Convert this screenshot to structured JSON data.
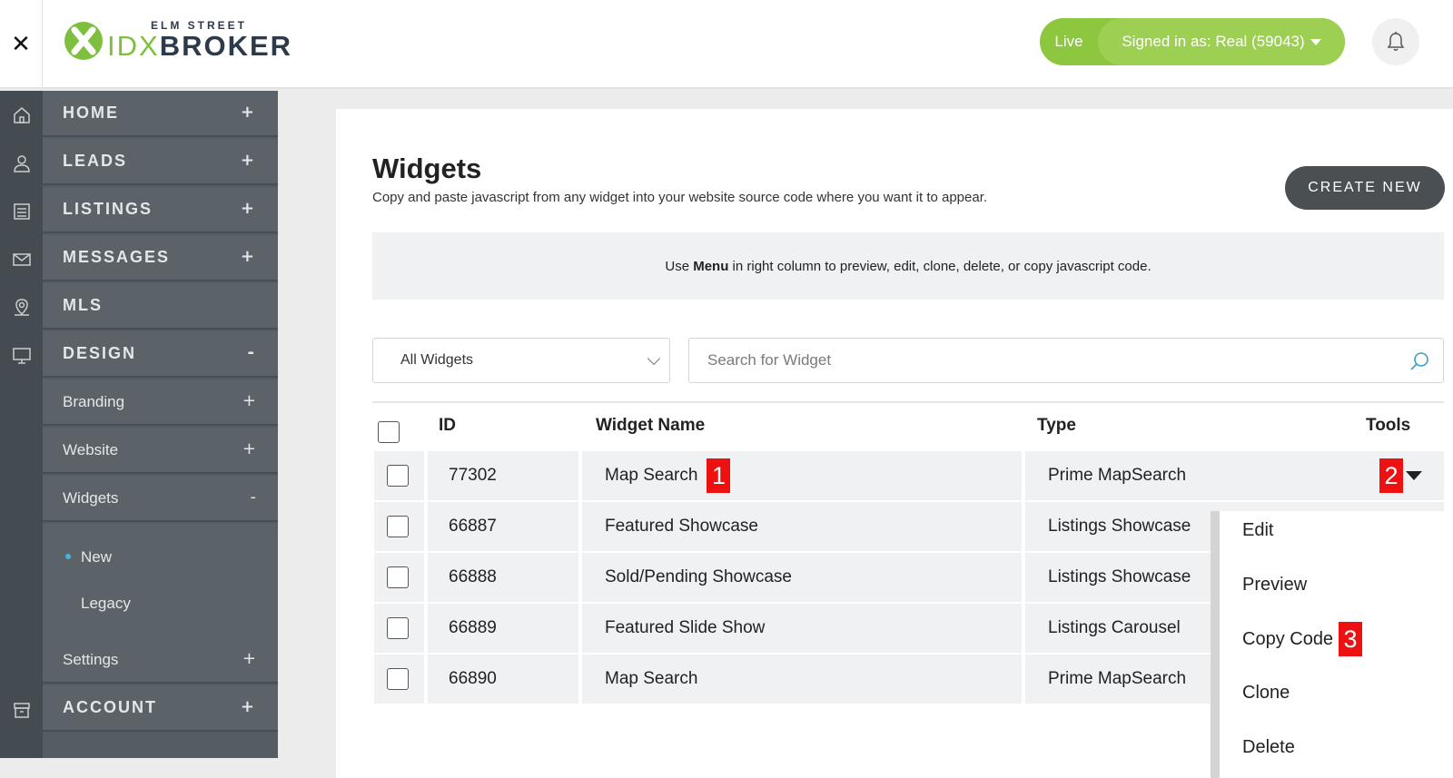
{
  "header": {
    "close_label": "✕",
    "logo": {
      "small": "ELM STREET",
      "idx": "IDX",
      "broker": "BROKER"
    },
    "status": {
      "live": "Live",
      "signed_in": "Signed in as: Real (59043)"
    },
    "colors": {
      "accent": "#8dc63f",
      "sidebar": "#5b6369",
      "rail": "#444c52"
    }
  },
  "rail_icons": [
    "home-icon",
    "user-icon",
    "listings-icon",
    "mail-icon",
    "location-icon",
    "monitor-icon",
    "archive-icon"
  ],
  "sidebar": {
    "items": [
      {
        "label": "HOME",
        "toggle": "+"
      },
      {
        "label": "LEADS",
        "toggle": "+"
      },
      {
        "label": "LISTINGS",
        "toggle": "+"
      },
      {
        "label": "MESSAGES",
        "toggle": "+"
      },
      {
        "label": "MLS",
        "toggle": ""
      },
      {
        "label": "DESIGN",
        "toggle": "-"
      },
      {
        "label": "Branding",
        "toggle": "+"
      },
      {
        "label": "Website",
        "toggle": "+"
      },
      {
        "label": "Widgets",
        "toggle": "-"
      },
      {
        "label": "Settings",
        "toggle": "+"
      },
      {
        "label": "ACCOUNT",
        "toggle": "+"
      }
    ],
    "widgets_sub": {
      "new": "New",
      "legacy": "Legacy"
    }
  },
  "main": {
    "title": "Widgets",
    "subtitle": "Copy and paste javascript from any widget into your website source code where you want it to appear.",
    "create_label": "CREATE NEW",
    "info": {
      "pre": "Use ",
      "bold": "Menu",
      "post": " in right column to preview, edit, clone, delete, or copy javascript code."
    },
    "filter_value": "All Widgets",
    "search_placeholder": "Search for Widget",
    "table": {
      "headers": {
        "id": "ID",
        "name": "Widget Name",
        "type": "Type",
        "tools": "Tools"
      },
      "rows": [
        {
          "id": "77302",
          "name": "Map Search",
          "type": "Prime MapSearch"
        },
        {
          "id": "66887",
          "name": "Featured Showcase",
          "type": "Listings Showcase"
        },
        {
          "id": "66888",
          "name": "Sold/Pending Showcase",
          "type": "Listings Showcase"
        },
        {
          "id": "66889",
          "name": "Featured Slide Show",
          "type": "Listings Carousel"
        },
        {
          "id": "66890",
          "name": "Map Search",
          "type": "Prime MapSearch"
        }
      ]
    },
    "menu": {
      "edit": "Edit",
      "preview": "Preview",
      "copy": "Copy Code",
      "clone": "Clone",
      "delete": "Delete"
    },
    "badges": {
      "one": "1",
      "two": "2",
      "three": "3"
    }
  }
}
